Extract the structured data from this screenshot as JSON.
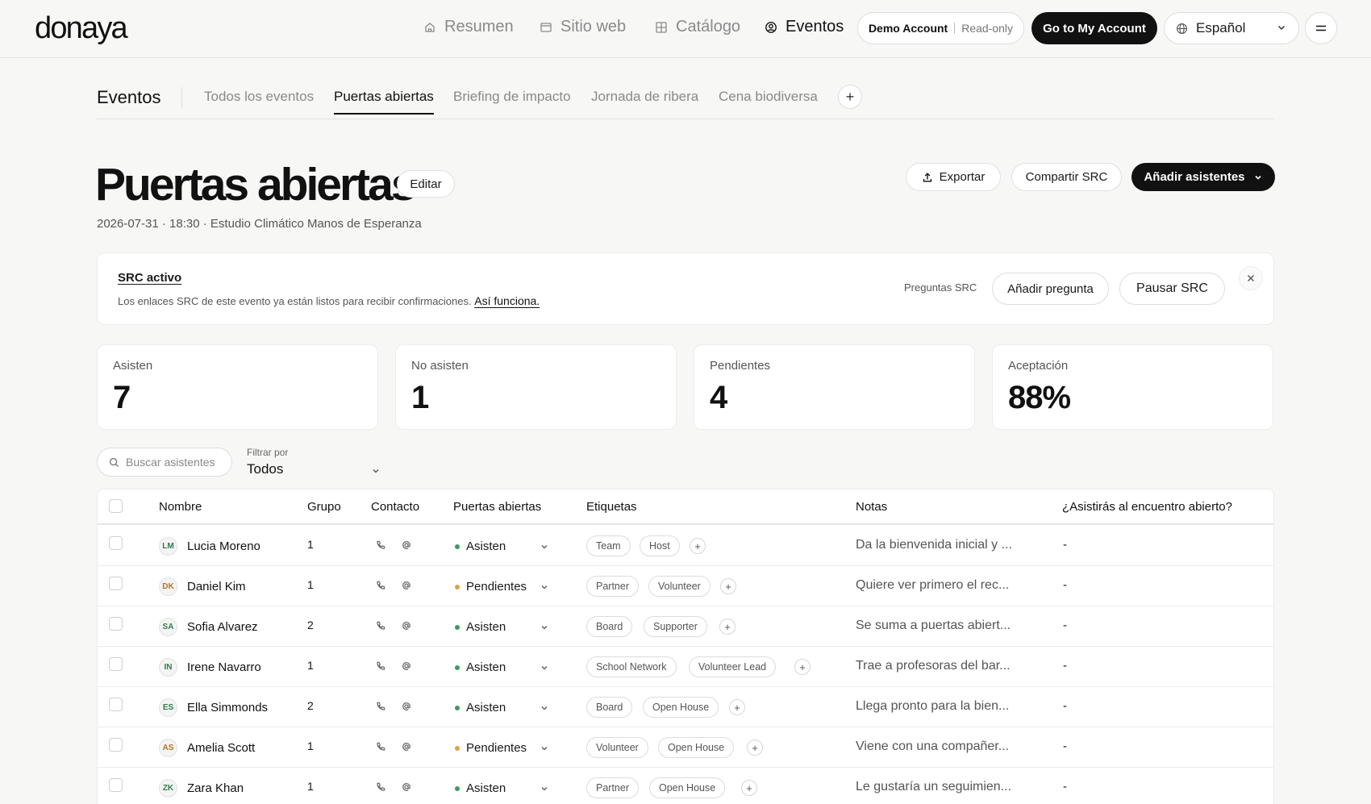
{
  "brand": "donaya",
  "nav": {
    "items": [
      {
        "label": "Resumen",
        "icon": "home-icon"
      },
      {
        "label": "Sitio web",
        "icon": "browser-icon"
      },
      {
        "label": "Catálogo",
        "icon": "grid-icon"
      },
      {
        "label": "Eventos",
        "icon": "user-circle-icon"
      }
    ],
    "demo_account": "Demo Account",
    "read_only": "Read-only",
    "go_account": "Go to My Account",
    "language": "Español"
  },
  "subnav": {
    "section": "Eventos",
    "tabs": [
      "Todos los eventos",
      "Puertas abiertas",
      "Briefing de impacto",
      "Jornada de ribera",
      "Cena biodiversa"
    ],
    "active_tab": "Puertas abiertas",
    "add": "+"
  },
  "event": {
    "title": "Puertas abiertas",
    "edit": "Editar",
    "meta": "2026-07-31 · 18:30 · Estudio Climático Manos de Esperanza",
    "export": "Exportar",
    "share": "Compartir SRC",
    "add_attendees": "Añadir asistentes"
  },
  "banner": {
    "title": "SRC activo",
    "description": "Los enlaces SRC de este evento ya están listos para recibir confirmaciones.",
    "link": "Así funciona.",
    "questions_label": "Preguntas SRC",
    "add_question": "Añadir pregunta",
    "pause": "Pausar SRC"
  },
  "stats": [
    {
      "label": "Asisten",
      "value": "7"
    },
    {
      "label": "No asisten",
      "value": "1"
    },
    {
      "label": "Pendientes",
      "value": "4"
    },
    {
      "label": "Aceptación",
      "value": "88%"
    }
  ],
  "filters": {
    "search_placeholder": "Buscar asistentes",
    "filter_label": "Filtrar por",
    "filter_value": "Todos"
  },
  "table": {
    "columns": [
      "Nombre",
      "Grupo",
      "Contacto",
      "Puertas abiertas",
      "Etiquetas",
      "Notas",
      "¿Asistirás al encuentro abierto?"
    ],
    "rows": [
      {
        "initials": "LM",
        "name": "Lucia Moreno",
        "group": "1",
        "status": "Asisten",
        "tags": [
          "Team",
          "Host"
        ],
        "note": "Da la bienvenida inicial y ...",
        "answer": "-"
      },
      {
        "initials": "DK",
        "name": "Daniel Kim",
        "group": "1",
        "status": "Pendientes",
        "tags": [
          "Partner",
          "Volunteer"
        ],
        "note": "Quiere ver primero el rec...",
        "answer": "-"
      },
      {
        "initials": "SA",
        "name": "Sofia Alvarez",
        "group": "2",
        "status": "Asisten",
        "tags": [
          "Board",
          "Supporter"
        ],
        "note": "Se suma a puertas abiert...",
        "answer": "-"
      },
      {
        "initials": "IN",
        "name": "Irene Navarro",
        "group": "1",
        "status": "Asisten",
        "tags": [
          "School Network",
          "Volunteer Lead"
        ],
        "note": "Trae a profesoras del bar...",
        "answer": "-"
      },
      {
        "initials": "ES",
        "name": "Ella Simmonds",
        "group": "2",
        "status": "Asisten",
        "tags": [
          "Board",
          "Open House"
        ],
        "note": "Llega pronto para la bien...",
        "answer": "-"
      },
      {
        "initials": "AS",
        "name": "Amelia Scott",
        "group": "1",
        "status": "Pendientes",
        "tags": [
          "Volunteer",
          "Open House"
        ],
        "note": "Viene con una compañer...",
        "answer": "-"
      },
      {
        "initials": "ZK",
        "name": "Zara Khan",
        "group": "1",
        "status": "Asisten",
        "tags": [
          "Partner",
          "Open House"
        ],
        "note": "Le gustaría un seguimien...",
        "answer": "-"
      }
    ]
  },
  "colors": {
    "attending": "#3f9b5f",
    "pending": "#e0a14a",
    "primary": "#111111"
  }
}
